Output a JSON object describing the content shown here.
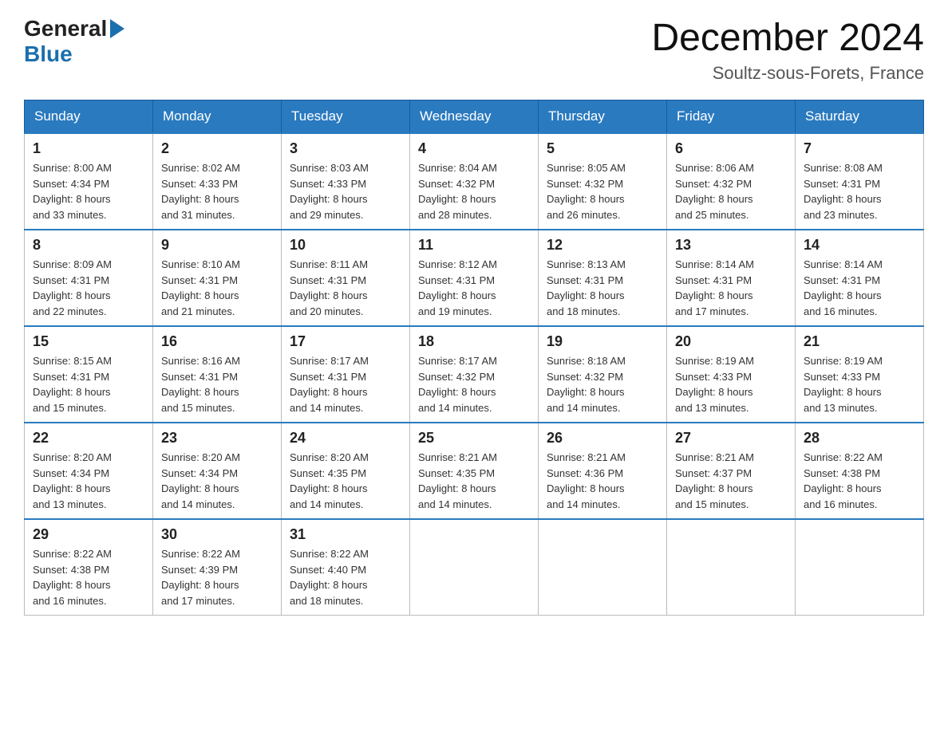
{
  "header": {
    "logo_general": "General",
    "logo_blue": "Blue",
    "month_title": "December 2024",
    "location": "Soultz-sous-Forets, France"
  },
  "days_of_week": [
    "Sunday",
    "Monday",
    "Tuesday",
    "Wednesday",
    "Thursday",
    "Friday",
    "Saturday"
  ],
  "weeks": [
    [
      {
        "day": "1",
        "sunrise": "8:00 AM",
        "sunset": "4:34 PM",
        "daylight": "8 hours and 33 minutes."
      },
      {
        "day": "2",
        "sunrise": "8:02 AM",
        "sunset": "4:33 PM",
        "daylight": "8 hours and 31 minutes."
      },
      {
        "day": "3",
        "sunrise": "8:03 AM",
        "sunset": "4:33 PM",
        "daylight": "8 hours and 29 minutes."
      },
      {
        "day": "4",
        "sunrise": "8:04 AM",
        "sunset": "4:32 PM",
        "daylight": "8 hours and 28 minutes."
      },
      {
        "day": "5",
        "sunrise": "8:05 AM",
        "sunset": "4:32 PM",
        "daylight": "8 hours and 26 minutes."
      },
      {
        "day": "6",
        "sunrise": "8:06 AM",
        "sunset": "4:32 PM",
        "daylight": "8 hours and 25 minutes."
      },
      {
        "day": "7",
        "sunrise": "8:08 AM",
        "sunset": "4:31 PM",
        "daylight": "8 hours and 23 minutes."
      }
    ],
    [
      {
        "day": "8",
        "sunrise": "8:09 AM",
        "sunset": "4:31 PM",
        "daylight": "8 hours and 22 minutes."
      },
      {
        "day": "9",
        "sunrise": "8:10 AM",
        "sunset": "4:31 PM",
        "daylight": "8 hours and 21 minutes."
      },
      {
        "day": "10",
        "sunrise": "8:11 AM",
        "sunset": "4:31 PM",
        "daylight": "8 hours and 20 minutes."
      },
      {
        "day": "11",
        "sunrise": "8:12 AM",
        "sunset": "4:31 PM",
        "daylight": "8 hours and 19 minutes."
      },
      {
        "day": "12",
        "sunrise": "8:13 AM",
        "sunset": "4:31 PM",
        "daylight": "8 hours and 18 minutes."
      },
      {
        "day": "13",
        "sunrise": "8:14 AM",
        "sunset": "4:31 PM",
        "daylight": "8 hours and 17 minutes."
      },
      {
        "day": "14",
        "sunrise": "8:14 AM",
        "sunset": "4:31 PM",
        "daylight": "8 hours and 16 minutes."
      }
    ],
    [
      {
        "day": "15",
        "sunrise": "8:15 AM",
        "sunset": "4:31 PM",
        "daylight": "8 hours and 15 minutes."
      },
      {
        "day": "16",
        "sunrise": "8:16 AM",
        "sunset": "4:31 PM",
        "daylight": "8 hours and 15 minutes."
      },
      {
        "day": "17",
        "sunrise": "8:17 AM",
        "sunset": "4:31 PM",
        "daylight": "8 hours and 14 minutes."
      },
      {
        "day": "18",
        "sunrise": "8:17 AM",
        "sunset": "4:32 PM",
        "daylight": "8 hours and 14 minutes."
      },
      {
        "day": "19",
        "sunrise": "8:18 AM",
        "sunset": "4:32 PM",
        "daylight": "8 hours and 14 minutes."
      },
      {
        "day": "20",
        "sunrise": "8:19 AM",
        "sunset": "4:33 PM",
        "daylight": "8 hours and 13 minutes."
      },
      {
        "day": "21",
        "sunrise": "8:19 AM",
        "sunset": "4:33 PM",
        "daylight": "8 hours and 13 minutes."
      }
    ],
    [
      {
        "day": "22",
        "sunrise": "8:20 AM",
        "sunset": "4:34 PM",
        "daylight": "8 hours and 13 minutes."
      },
      {
        "day": "23",
        "sunrise": "8:20 AM",
        "sunset": "4:34 PM",
        "daylight": "8 hours and 14 minutes."
      },
      {
        "day": "24",
        "sunrise": "8:20 AM",
        "sunset": "4:35 PM",
        "daylight": "8 hours and 14 minutes."
      },
      {
        "day": "25",
        "sunrise": "8:21 AM",
        "sunset": "4:35 PM",
        "daylight": "8 hours and 14 minutes."
      },
      {
        "day": "26",
        "sunrise": "8:21 AM",
        "sunset": "4:36 PM",
        "daylight": "8 hours and 14 minutes."
      },
      {
        "day": "27",
        "sunrise": "8:21 AM",
        "sunset": "4:37 PM",
        "daylight": "8 hours and 15 minutes."
      },
      {
        "day": "28",
        "sunrise": "8:22 AM",
        "sunset": "4:38 PM",
        "daylight": "8 hours and 16 minutes."
      }
    ],
    [
      {
        "day": "29",
        "sunrise": "8:22 AM",
        "sunset": "4:38 PM",
        "daylight": "8 hours and 16 minutes."
      },
      {
        "day": "30",
        "sunrise": "8:22 AM",
        "sunset": "4:39 PM",
        "daylight": "8 hours and 17 minutes."
      },
      {
        "day": "31",
        "sunrise": "8:22 AM",
        "sunset": "4:40 PM",
        "daylight": "8 hours and 18 minutes."
      },
      null,
      null,
      null,
      null
    ]
  ],
  "labels": {
    "sunrise_prefix": "Sunrise: ",
    "sunset_prefix": "Sunset: ",
    "daylight_prefix": "Daylight: "
  }
}
